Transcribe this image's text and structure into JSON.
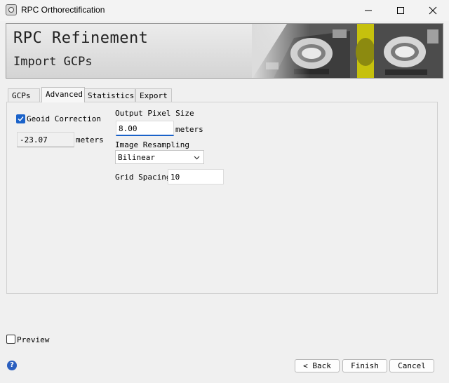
{
  "window": {
    "title": "RPC Orthorectification"
  },
  "banner": {
    "title": "RPC Refinement",
    "subtitle": "Import GCPs"
  },
  "tabs": [
    {
      "label": "GCPs",
      "active": false
    },
    {
      "label": "Advanced",
      "active": true
    },
    {
      "label": "Statistics",
      "active": false
    },
    {
      "label": "Export",
      "active": false
    }
  ],
  "advanced": {
    "geoid_correction": {
      "label": "Geoid Correction",
      "checked": true,
      "value": "-23.07",
      "unit": "meters"
    },
    "output_pixel_size": {
      "label": "Output Pixel Size",
      "value": "8.00",
      "unit": "meters"
    },
    "image_resampling": {
      "label": "Image Resampling",
      "selected": "Bilinear"
    },
    "grid_spacing": {
      "label": "Grid Spacing",
      "value": "10"
    }
  },
  "preview": {
    "label": "Preview",
    "checked": false
  },
  "buttons": {
    "back": "< Back",
    "finish": "Finish",
    "cancel": "Cancel"
  },
  "help_glyph": "?",
  "colors": {
    "accent": "#1a62c9",
    "imagery_highlight": "#d9d400"
  },
  "icons": [
    "app-icon",
    "minimize-icon",
    "maximize-icon",
    "close-icon",
    "check-icon",
    "chevron-down-icon",
    "help-icon"
  ]
}
